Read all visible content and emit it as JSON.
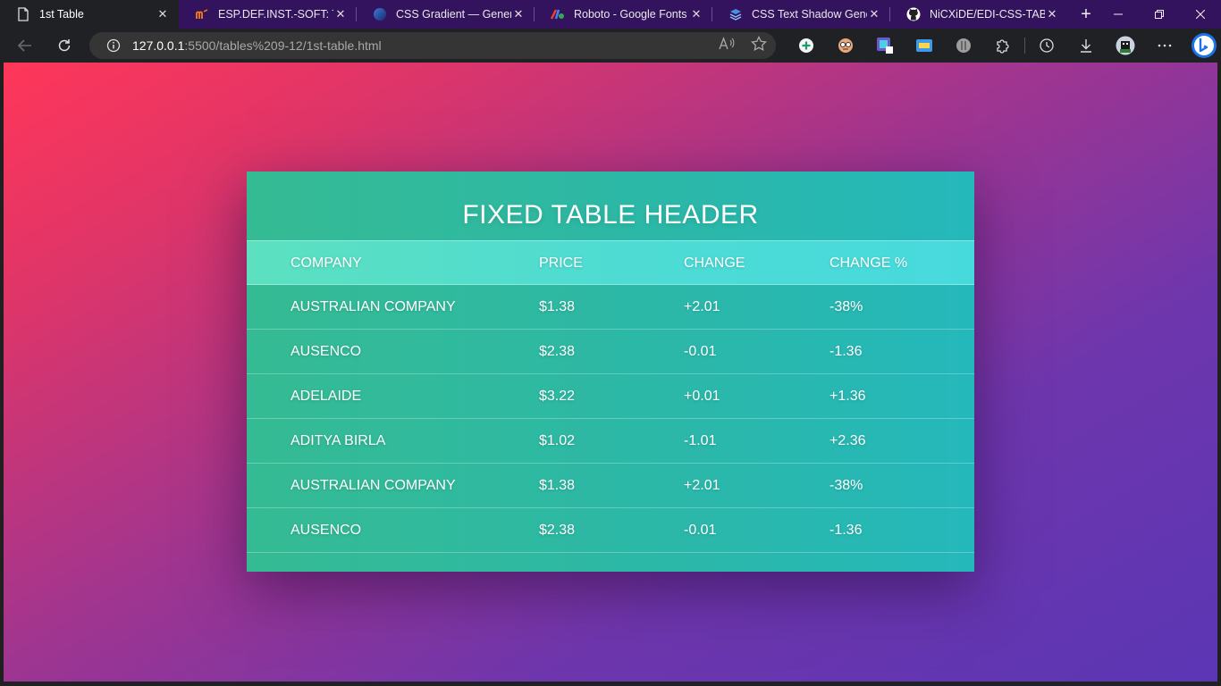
{
  "browser": {
    "tabs": [
      {
        "title": "1st Table",
        "active": true,
        "icon": "page-icon"
      },
      {
        "title": "ESP.DEF.INST.-SOFT: TP",
        "active": false,
        "icon": "moodle-icon"
      },
      {
        "title": "CSS Gradient — Genera",
        "active": false,
        "icon": "cssgradient-icon"
      },
      {
        "title": "Roboto - Google Fonts",
        "active": false,
        "icon": "google-fonts-icon"
      },
      {
        "title": "CSS Text Shadow Gener",
        "active": false,
        "icon": "stack-icon"
      },
      {
        "title": "NiCXiDE/EDI-CSS-TABLE",
        "active": false,
        "icon": "github-icon"
      }
    ],
    "url_host": "127.0.0.1",
    "url_rest": ":5500/tables%209-12/1st-table.html",
    "colors": {
      "tabstrip": "#34135e",
      "toolbar": "#202124"
    }
  },
  "page": {
    "title": "FIXED TABLE HEADER",
    "columns": [
      "COMPANY",
      "PRICE",
      "CHANGE",
      "CHANGE %"
    ],
    "rows": [
      [
        "AUSTRALIAN COMPANY",
        "$1.38",
        "+2.01",
        "-38%"
      ],
      [
        "AUSENCO",
        "$2.38",
        "-0.01",
        "-1.36"
      ],
      [
        "ADELAIDE",
        "$3.22",
        "+0.01",
        "+1.36"
      ],
      [
        "ADITYA BIRLA",
        "$1.02",
        "-1.01",
        "+2.36"
      ],
      [
        "AUSTRALIAN COMPANY",
        "$1.38",
        "+2.01",
        "-38%"
      ],
      [
        "AUSENCO",
        "$2.38",
        "-0.01",
        "-1.36"
      ]
    ],
    "colors": {
      "gradient_start": "#ff3659",
      "gradient_end": "#5b36b4",
      "card": "#2cb8a7"
    }
  }
}
